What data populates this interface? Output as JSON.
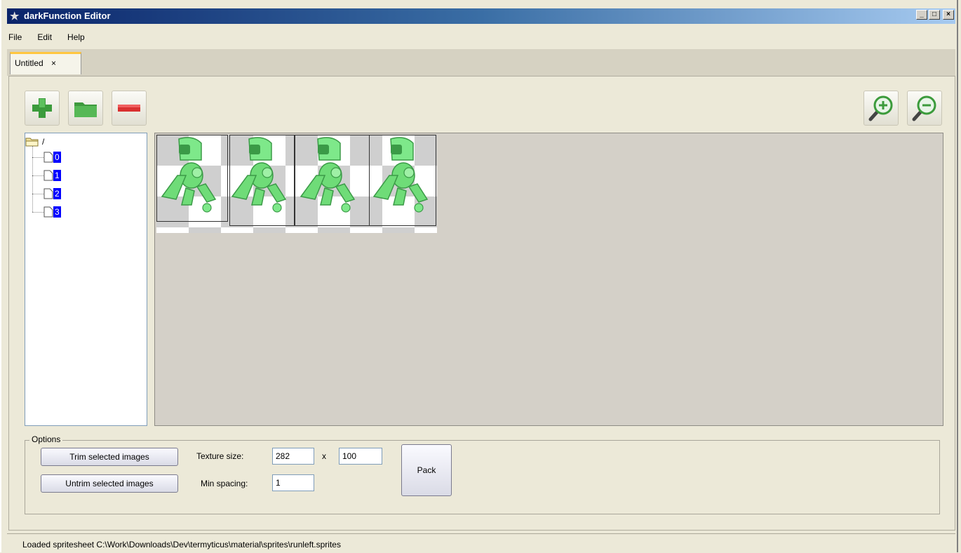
{
  "window": {
    "title": "darkFunction Editor",
    "minimize": "_",
    "maximize": "□",
    "close": "×"
  },
  "menu": [
    {
      "label": "File"
    },
    {
      "label": "Edit"
    },
    {
      "label": "Help"
    }
  ],
  "tab": {
    "label": "Untitled",
    "close": "×"
  },
  "toolbar": {
    "add_icon": "plus-icon",
    "folder_icon": "folder-icon",
    "remove_icon": "minus-icon",
    "zoom_in_icon": "zoom-in-icon",
    "zoom_out_icon": "zoom-out-icon"
  },
  "tree": {
    "root": "/",
    "items": [
      {
        "label": "0"
      },
      {
        "label": "1"
      },
      {
        "label": "2"
      },
      {
        "label": "3"
      }
    ]
  },
  "options": {
    "legend": "Options",
    "trim_label": "Trim selected images",
    "untrim_label": "Untrim selected images",
    "texture_label": "Texture size:",
    "texture_width": "282",
    "x_sep": "x",
    "texture_height": "100",
    "spacing_label": "Min spacing:",
    "spacing_value": "1",
    "pack_label": "Pack"
  },
  "status": {
    "text": "Loaded spritesheet C:\\Work\\Downloads\\Dev\\termyticus\\material\\sprites\\runleft.sprites"
  },
  "colors": {
    "selection": "#0000ff",
    "sprite_green": "#6fdc78",
    "tab_accent": "#ffc640"
  }
}
